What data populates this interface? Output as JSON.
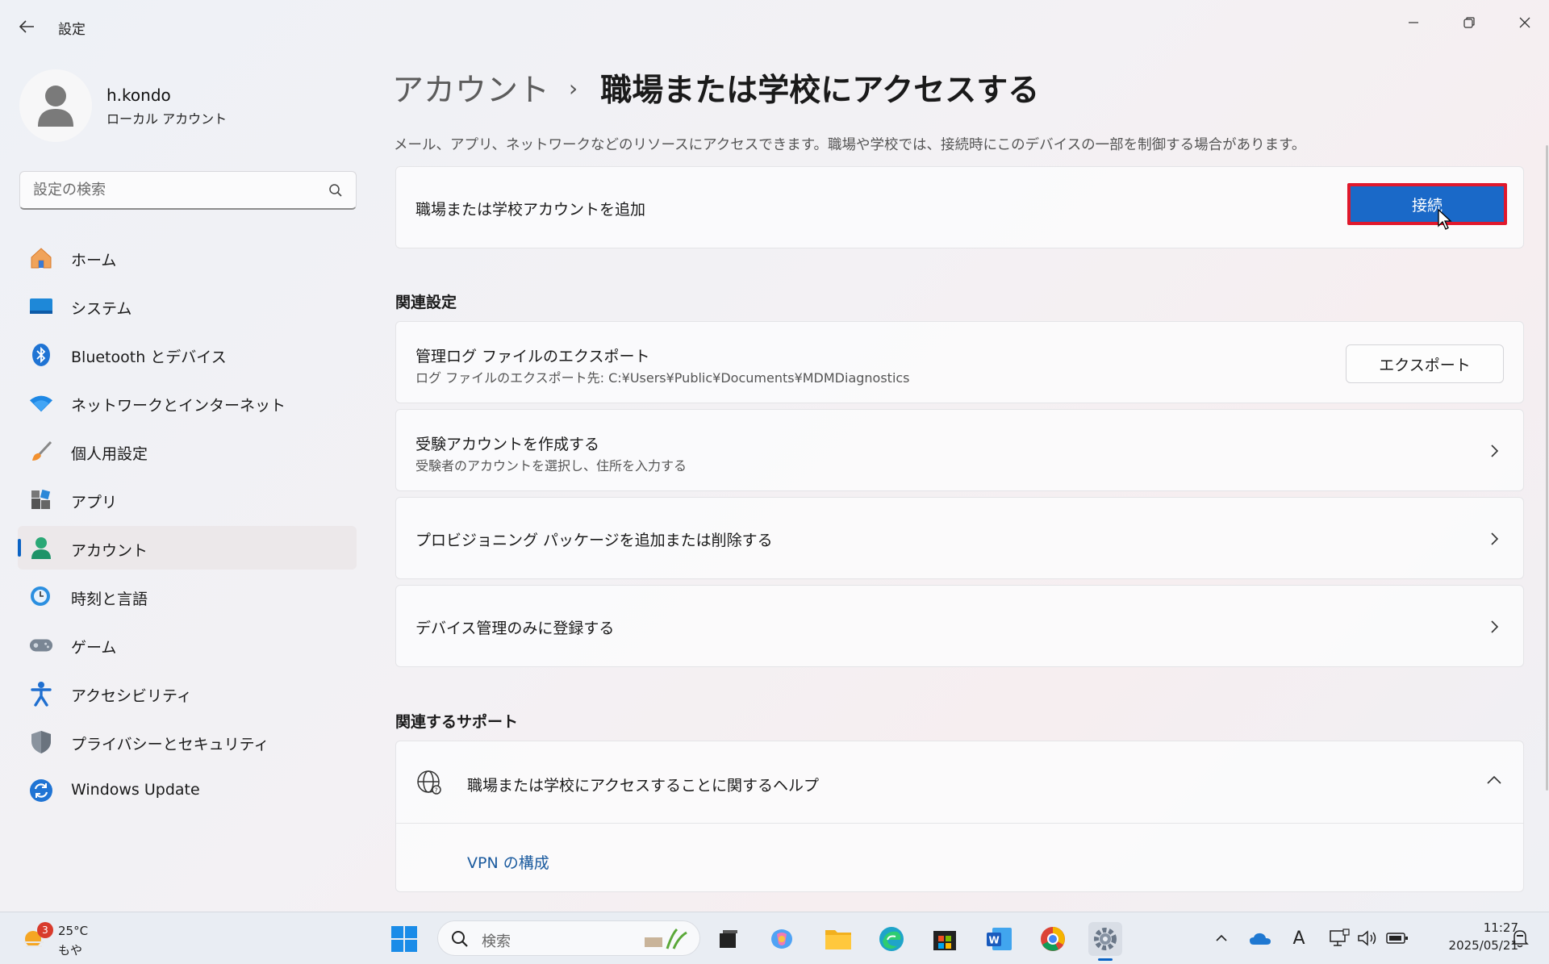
{
  "window": {
    "title": "設定"
  },
  "profile": {
    "name": "h.kondo",
    "account_type": "ローカル アカウント"
  },
  "search": {
    "placeholder": "設定の検索"
  },
  "sidebar": {
    "items": [
      {
        "label": "ホーム",
        "icon": "home-icon"
      },
      {
        "label": "システム",
        "icon": "system-icon"
      },
      {
        "label": "Bluetooth とデバイス",
        "icon": "bluetooth-icon"
      },
      {
        "label": "ネットワークとインターネット",
        "icon": "wifi-icon"
      },
      {
        "label": "個人用設定",
        "icon": "brush-icon"
      },
      {
        "label": "アプリ",
        "icon": "apps-icon"
      },
      {
        "label": "アカウント",
        "icon": "account-icon",
        "active": true
      },
      {
        "label": "時刻と言語",
        "icon": "time-language-icon"
      },
      {
        "label": "ゲーム",
        "icon": "gamepad-icon"
      },
      {
        "label": "アクセシビリティ",
        "icon": "accessibility-icon"
      },
      {
        "label": "プライバシーとセキュリティ",
        "icon": "shield-icon"
      },
      {
        "label": "Windows Update",
        "icon": "update-icon"
      }
    ]
  },
  "main": {
    "breadcrumb_parent": "アカウント",
    "breadcrumb_separator": "›",
    "page_title": "職場または学校にアクセスする",
    "description": "メール、アプリ、ネットワークなどのリソースにアクセスできます。職場や学校では、接続時にこのデバイスの一部を制御する場合があります。",
    "add_account": {
      "label": "職場または学校アカウントを追加",
      "button": "接続"
    },
    "related_settings_title": "関連設定",
    "export": {
      "title": "管理ログ ファイルのエクスポート",
      "subtitle": "ログ ファイルのエクスポート先: C:¥Users¥Public¥Documents¥MDMDiagnostics",
      "button": "エクスポート"
    },
    "exam_account": {
      "title": "受験アカウントを作成する",
      "subtitle": "受験者のアカウントを選択し、住所を入力する"
    },
    "provisioning": {
      "title": "プロビジョニング パッケージを追加または削除する"
    },
    "device_management": {
      "title": "デバイス管理のみに登録する"
    },
    "related_support_title": "関連するサポート",
    "help": {
      "title": "職場または学校にアクセスすることに関するヘルプ",
      "link": "VPN の構成"
    }
  },
  "taskbar": {
    "weather": {
      "badge": "3",
      "temp": "25°C",
      "condition": "もや"
    },
    "search_label": "検索",
    "time": "11:27",
    "date": "2025/05/21",
    "ime": "A"
  },
  "colors": {
    "accent": "#1a69c8",
    "highlight_border": "#e0182c",
    "link": "#1a5a9e"
  }
}
